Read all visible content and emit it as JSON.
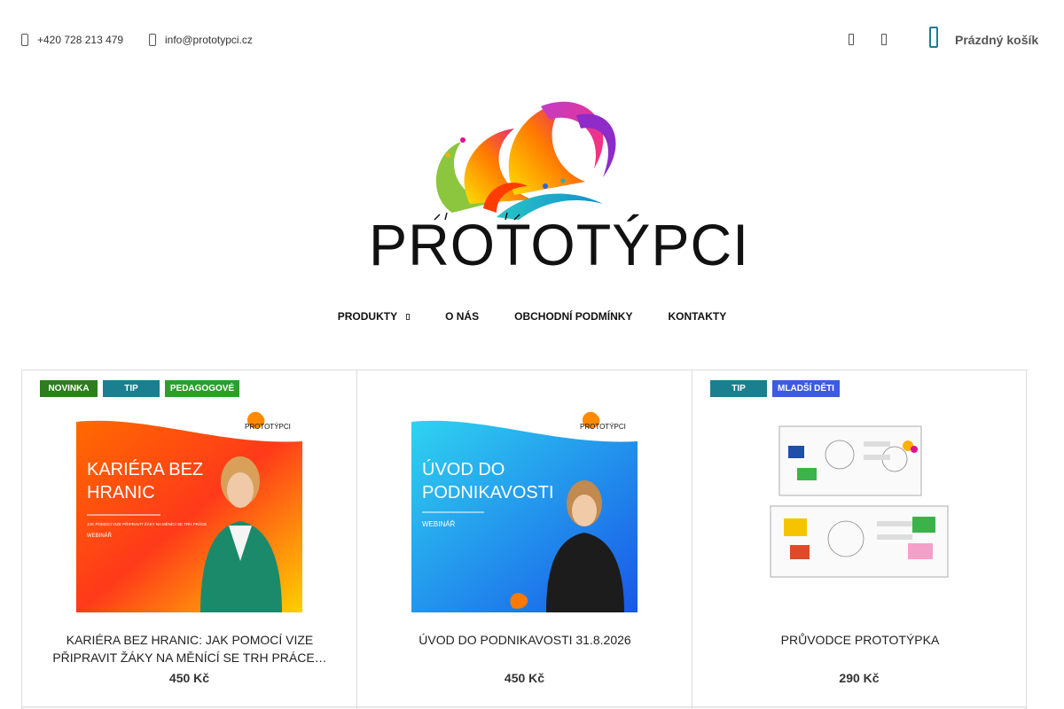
{
  "header": {
    "phone": "+420 728 213 479",
    "email": "info@prototypci.cz",
    "cart_label": "Prázdný košík",
    "icons": [
      "phone-icon",
      "mail-icon",
      "user-icon",
      "search-icon",
      "cart-icon"
    ]
  },
  "logo": {
    "text": "PROTOTÝPCI"
  },
  "nav": {
    "items": [
      {
        "label": "PRODUKTY",
        "has_submenu": true
      },
      {
        "label": "O NÁS"
      },
      {
        "label": "OBCHODNÍ PODMÍNKY"
      },
      {
        "label": "KONTAKTY"
      }
    ]
  },
  "colors": {
    "accent": "#1a7f8e",
    "badge_novinka": "#2e7d1e",
    "badge_tip": "#1a7f8e",
    "badge_pedagogove": "#2aa02a",
    "badge_mladsi": "#3d5be0"
  },
  "products": [
    {
      "badges": [
        {
          "label": "NOVINKA",
          "color": "#2e7d1e"
        },
        {
          "label": "TIP",
          "color": "#1a7f8e"
        },
        {
          "label": "PEDAGOGOVÉ",
          "color": "#2aa02a"
        }
      ],
      "image_heading": "KARIÉRA BEZ HRANIC",
      "image_sub": "JAK POMOCÍ VIZE PŘIPRAVIT ŽÁKY NA MĚNÍCÍ SE TRH PRÁCE",
      "image_tag": "WEBINÁŘ",
      "title": "KARIÉRA BEZ HRANIC: JAK POMOCÍ VIZE PŘIPRAVIT ŽÁKY NA MĚNÍCÍ SE TRH PRÁCE…",
      "price": "450 Kč"
    },
    {
      "badges": [],
      "image_heading": "ÚVOD DO PODNIKAVOSTI",
      "image_tag": "WEBINÁŘ",
      "title": "ÚVOD DO PODNIKAVOSTI 31.8.2026",
      "price": "450 Kč"
    },
    {
      "badges": [
        {
          "label": "TIP",
          "color": "#1a7f8e"
        },
        {
          "label": "MLADŠÍ DĚTI",
          "color": "#3d5be0"
        }
      ],
      "title": "PRŮVODCE PROTOTÝPKA",
      "price": "290 Kč"
    }
  ]
}
